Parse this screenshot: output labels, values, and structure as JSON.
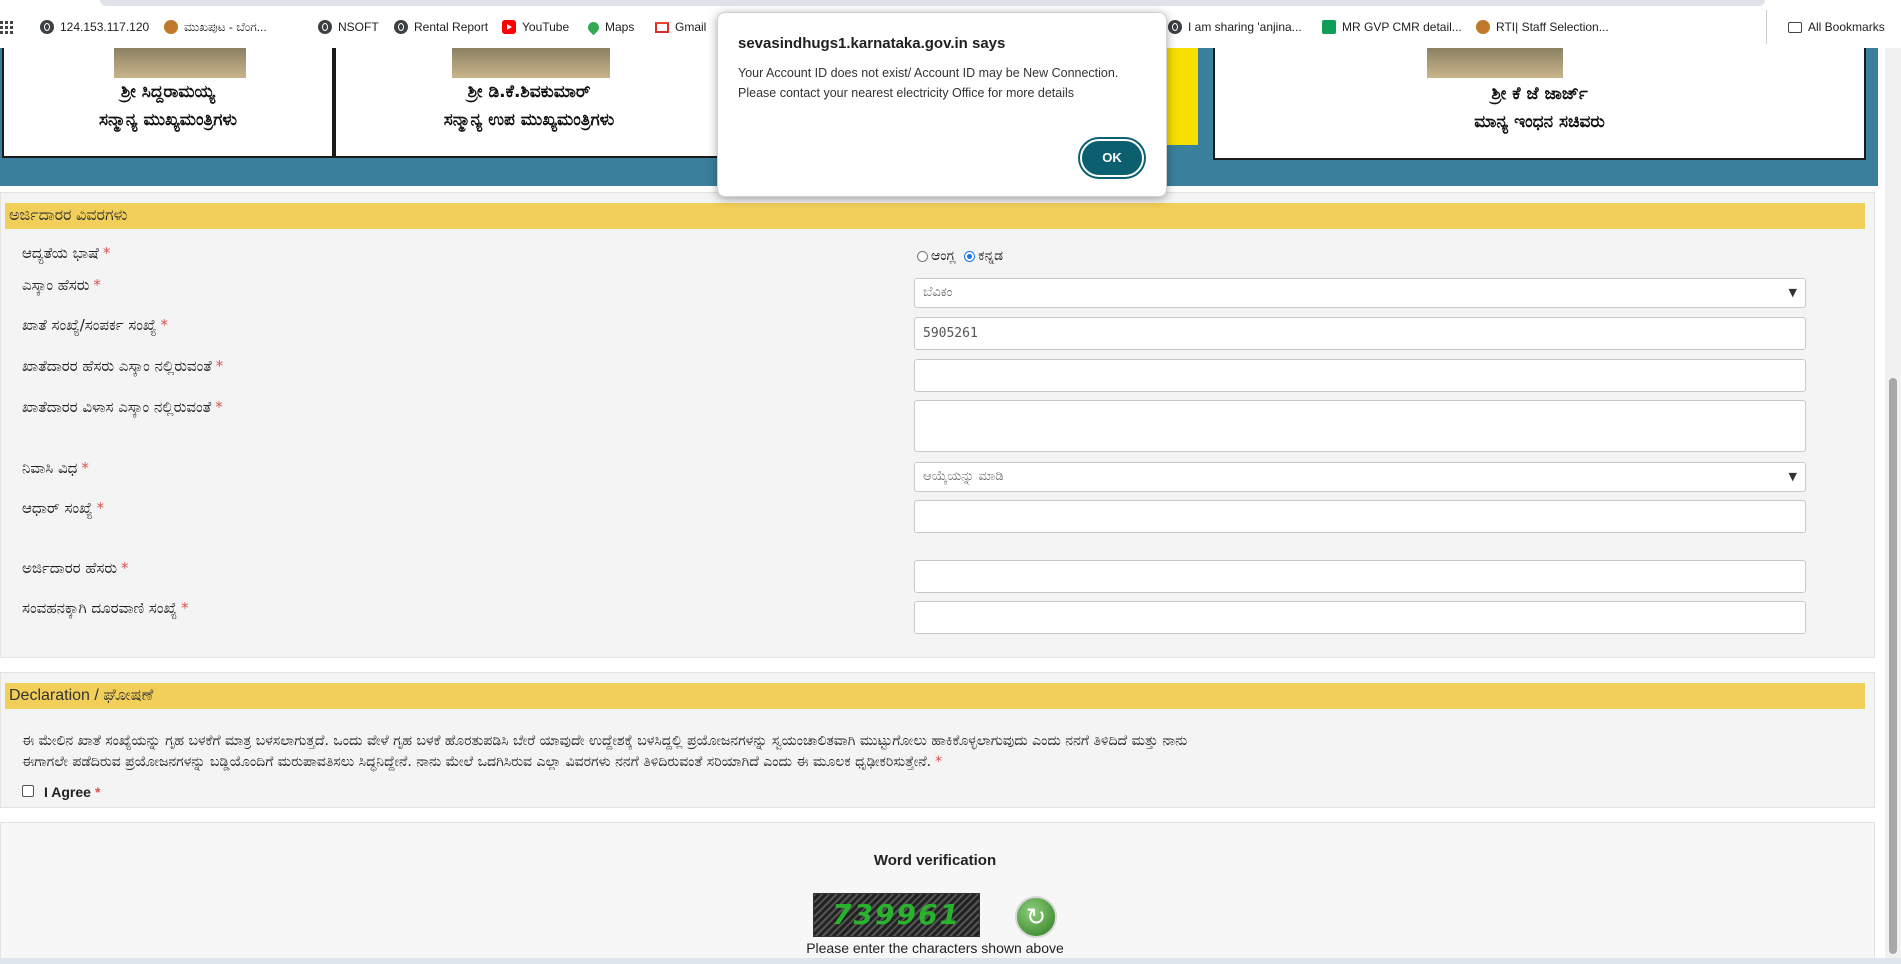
{
  "bookmarks": {
    "items": [
      {
        "label": "124.153.117.120",
        "icon": "globe-icon"
      },
      {
        "label": "ಮುಖಪುಟ - ಬೆಂಗ...",
        "icon": "emblem-icon"
      },
      {
        "label": "NSOFT",
        "icon": "globe-icon"
      },
      {
        "label": "Rental Report",
        "icon": "globe-icon"
      },
      {
        "label": "YouTube",
        "icon": "youtube-icon"
      },
      {
        "label": "Maps",
        "icon": "maps-icon"
      },
      {
        "label": "Gmail",
        "icon": "gmail-icon"
      },
      {
        "label": "I am sharing 'anjina...",
        "icon": "globe-icon"
      },
      {
        "label": "MR GVP CMR detail...",
        "icon": "sheets-icon"
      },
      {
        "label": "RTI| Staff Selection...",
        "icon": "emblem-icon"
      }
    ],
    "all_bookmarks": "All Bookmarks"
  },
  "banner": {
    "leaders": [
      {
        "name": "ಶ್ರೀ ಸಿದ್ದರಾಮಯ್ಯ",
        "title": "ಸನ್ಮಾನ್ಯ ಮುಖ್ಯಮಂತ್ರಿಗಳು"
      },
      {
        "name": "ಶ್ರೀ ಡಿ.ಕೆ.ಶಿವಕುಮಾರ್",
        "title": "ಸನ್ಮಾನ್ಯ ಉಪ ಮುಖ್ಯಮಂತ್ರಿಗಳು"
      },
      {
        "name": "ಶ್ರೀ ಕೆ ಜೆ ಜಾರ್ಜ್",
        "title": "ಮಾನ್ಯ ಇಂಧನ ಸಚಿವರು"
      }
    ]
  },
  "applicant": {
    "section_title": "ಅರ್ಜಿದಾರರ ವಿವರಗಳು",
    "required_mark": "*",
    "fields": {
      "language": {
        "label": "ಆದ್ಯತೆಯ ಭಾಷೆ",
        "options": [
          "ಆಂಗ್ಲ",
          "ಕನ್ನಡ"
        ],
        "selected": "ಕನ್ನಡ"
      },
      "escom": {
        "label": "ಎಸ್ಕಾಂ ಹೆಸರು",
        "value": "ಬೆವಿಕಂ"
      },
      "account": {
        "label": "ಖಾತೆ ಸಂಖ್ಯೆ/ಸಂಪರ್ಕ ಸಂಖ್ಯೆ",
        "value": "5905261"
      },
      "holder_name": {
        "label": "ಖಾತೆದಾರರ ಹೆಸರು ಎಸ್ಕಾಂ ನಲ್ಲಿರುವಂತೆ",
        "value": ""
      },
      "holder_address": {
        "label": "ಖಾತೆದಾರರ ವಿಳಾಸ ಎಸ್ಕಾಂ ನಲ್ಲಿರುವಂತೆ",
        "value": ""
      },
      "residence": {
        "label": "ನಿವಾಸಿ ವಿಧ",
        "value": "ಆಯ್ಕೆಯನ್ನು ಮಾಡಿ"
      },
      "aadhaar": {
        "label": "ಆಧಾರ್ ಸಂಖ್ಯೆ",
        "value": ""
      },
      "applicant_name": {
        "label": "ಅರ್ಜಿದಾರರ ಹೆಸರು",
        "value": ""
      },
      "phone": {
        "label": "ಸಂವಹನಕ್ಕಾಗಿ ದೂರವಾಣಿ ಸಂಖ್ಯೆ",
        "value": ""
      }
    }
  },
  "declaration": {
    "section_title": "Declaration / ಘೋಷಣೆ",
    "text_line1": "ಈ ಮೇಲಿನ ಖಾತೆ ಸಂಖ್ಯೆಯನ್ನು ಗೃಹ ಬಳಕೆಗೆ ಮಾತ್ರ ಬಳಸಲಾಗುತ್ತದೆ. ಒಂದು ವೇಳೆ ಗೃಹ ಬಳಕೆ ಹೊರತುಪಡಿಸಿ ಬೇರೆ ಯಾವುದೇ ಉದ್ದೇಶಕ್ಕೆ ಬಳಸಿದ್ದಲ್ಲಿ ಪ್ರಯೋಜನಗಳನ್ನು ಸ್ವಯಂಚಾಲಿತವಾಗಿ ಮುಟ್ಟುಗೋಲು ಹಾಕಿಕೊಳ್ಳಲಾಗುವುದು ಎಂದು ನನಗೆ ತಿಳಿದಿದೆ ಮತ್ತು ನಾನು",
    "text_line2": "ಈಗಾಗಲೇ ಪಡೆದಿರುವ ಪ್ರಯೋಜನಗಳನ್ನು ಬಡ್ಡಿಯೊಂದಿಗೆ ಮರುಪಾವತಿಸಲು ಸಿದ್ಧನಿದ್ದೇನೆ. ನಾನು ಮೇಲೆ ಒದಗಿಸಿರುವ ಎಲ್ಲಾ ವಿವರಗಳು ನನಗೆ ತಿಳಿದಿರುವಂತೆ ಸರಿಯಾಗಿದೆ ಎಂದು ಈ ಮೂಲಕ ಧೃಢೀಕರಿಸುತ್ತೇನೆ.",
    "agree_label": "I Agree"
  },
  "captcha": {
    "title": "Word verification",
    "code": "739961",
    "hint": "Please enter the characters shown above"
  },
  "dialog": {
    "title": "sevasindhugs1.karnataka.gov.in says",
    "message_line1": "Your Account ID does not exist/ Account ID may be New Connection.",
    "message_line2": "Please contact your nearest electricity Office for more details",
    "ok_label": "OK"
  },
  "colors": {
    "banner": "#3a7f9c",
    "section_header": "#f2cf58",
    "dialog_button": "#0b5f6f",
    "required": "#d9534f"
  }
}
